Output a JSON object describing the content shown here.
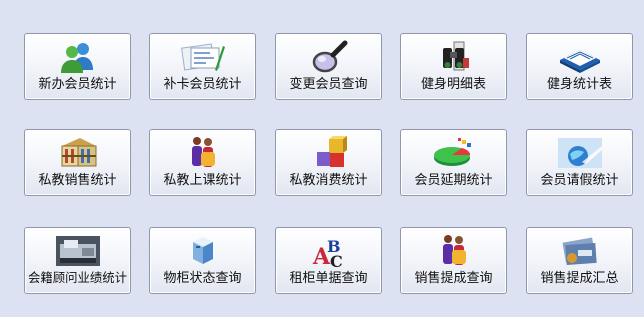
{
  "tiles": [
    {
      "label": "新办会员统计",
      "icon": "users-icon"
    },
    {
      "label": "补卡会员统计",
      "icon": "card-pen-icon"
    },
    {
      "label": "变更会员查询",
      "icon": "magnifier-icon"
    },
    {
      "label": "健身明细表",
      "icon": "binoculars-icon"
    },
    {
      "label": "健身统计表",
      "icon": "blue-book-icon"
    },
    {
      "label": "私教销售统计",
      "icon": "abacus-icon"
    },
    {
      "label": "私教上课统计",
      "icon": "people-group-icon"
    },
    {
      "label": "私教消费统计",
      "icon": "blocks-icon"
    },
    {
      "label": "会员延期统计",
      "icon": "pie-chart-icon"
    },
    {
      "label": "会员请假统计",
      "icon": "globe-icon"
    },
    {
      "label": "会籍顾问业绩统计",
      "icon": "machine-photo-icon"
    },
    {
      "label": "物柜状态查询",
      "icon": "cabinet-icon"
    },
    {
      "label": "租柜单据查询",
      "icon": "letters-icon"
    },
    {
      "label": "销售提成查询",
      "icon": "people-group-icon"
    },
    {
      "label": "销售提成汇总",
      "icon": "money-icon"
    }
  ]
}
